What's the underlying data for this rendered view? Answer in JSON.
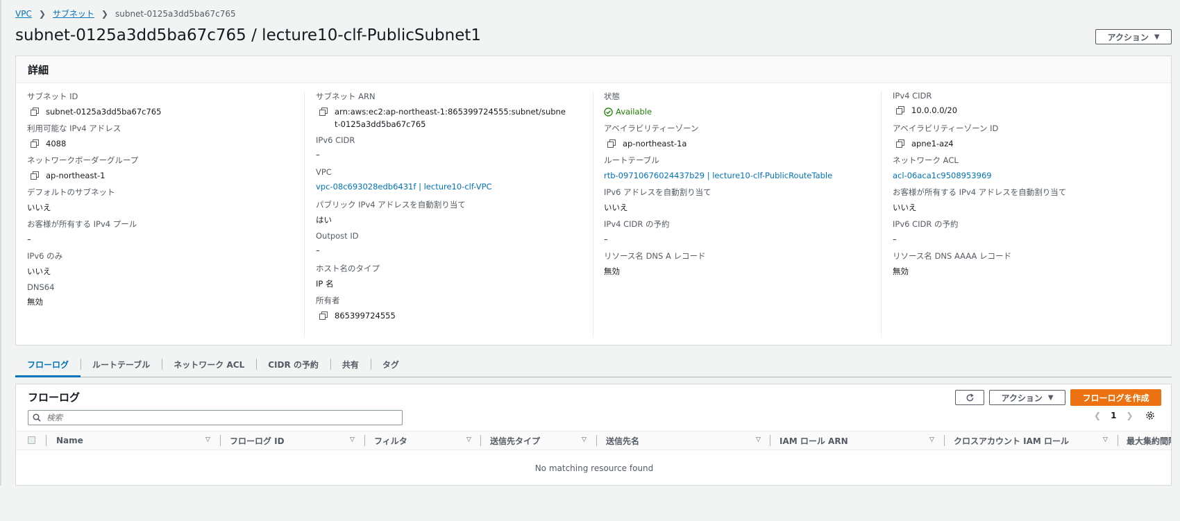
{
  "breadcrumb": {
    "items": [
      "VPC",
      "サブネット"
    ],
    "current": "subnet-0125a3dd5ba67c765"
  },
  "title": "subnet-0125a3dd5ba67c765 / lecture10-clf-PublicSubnet1",
  "actions_label": "アクション",
  "details": {
    "heading": "詳細",
    "col1": [
      {
        "label": "サブネット ID",
        "value": "subnet-0125a3dd5ba67c765"
      },
      {
        "label": "利用可能な IPv4 アドレス",
        "value": "4088"
      },
      {
        "label": "ネットワークボーダーグループ",
        "value": "ap-northeast-1"
      },
      {
        "label": "デフォルトのサブネット",
        "value": "いいえ"
      },
      {
        "label": "お客様が所有する IPv4 プール",
        "value": "–"
      },
      {
        "label": "IPv6 のみ",
        "value": "いいえ"
      },
      {
        "label": "DNS64",
        "value": "無効"
      }
    ],
    "col2": [
      {
        "label": "サブネット ARN",
        "value": "arn:aws:ec2:ap-northeast-1:865399724555:subnet/subnet-0125a3dd5ba67c765"
      },
      {
        "label": "IPv6 CIDR",
        "value": "–"
      },
      {
        "label": "VPC",
        "value": "vpc-08c693028edb6431f | lecture10-clf-VPC"
      },
      {
        "label": "パブリック IPv4 アドレスを自動割り当て",
        "value": "はい"
      },
      {
        "label": "Outpost ID",
        "value": "–"
      },
      {
        "label": "ホスト名のタイプ",
        "value": "IP 名"
      },
      {
        "label": "所有者",
        "value": "865399724555"
      }
    ],
    "col3": [
      {
        "label": "状態",
        "value": "Available"
      },
      {
        "label": "アベイラビリティーゾーン",
        "value": "ap-northeast-1a"
      },
      {
        "label": "ルートテーブル",
        "value": "rtb-09710676024437b29 | lecture10-clf-PublicRouteTable"
      },
      {
        "label": "IPv6 アドレスを自動割り当て",
        "value": "いいえ"
      },
      {
        "label": "IPv4 CIDR の予約",
        "value": "–"
      },
      {
        "label": "リソース名 DNS A レコード",
        "value": "無効"
      }
    ],
    "col4": [
      {
        "label": "IPv4 CIDR",
        "value": "10.0.0.0/20"
      },
      {
        "label": "アベイラビリティーゾーン ID",
        "value": "apne1-az4"
      },
      {
        "label": "ネットワーク ACL",
        "value": "acl-06aca1c9508953969"
      },
      {
        "label": "お客様が所有する IPv4 アドレスを自動割り当て",
        "value": "いいえ"
      },
      {
        "label": "IPv6 CIDR の予約",
        "value": "–"
      },
      {
        "label": "リソース名 DNS AAAA レコード",
        "value": "無効"
      }
    ]
  },
  "tabs": [
    "フローログ",
    "ルートテーブル",
    "ネットワーク ACL",
    "CIDR の予約",
    "共有",
    "タグ"
  ],
  "flowlog": {
    "heading": "フローログ",
    "actions_label": "アクション",
    "create_label": "フローログを作成",
    "search_placeholder": "検索",
    "page": "1",
    "columns": [
      "Name",
      "フローログ ID",
      "フィルタ",
      "送信先タイプ",
      "送信先名",
      "IAM ロール ARN",
      "クロスアカウント IAM ロール",
      "最大集約間隔"
    ],
    "empty": "No matching resource found"
  },
  "colors": {
    "link": "#0073bb",
    "success": "#1d8102",
    "primary_button": "#ec7211"
  }
}
